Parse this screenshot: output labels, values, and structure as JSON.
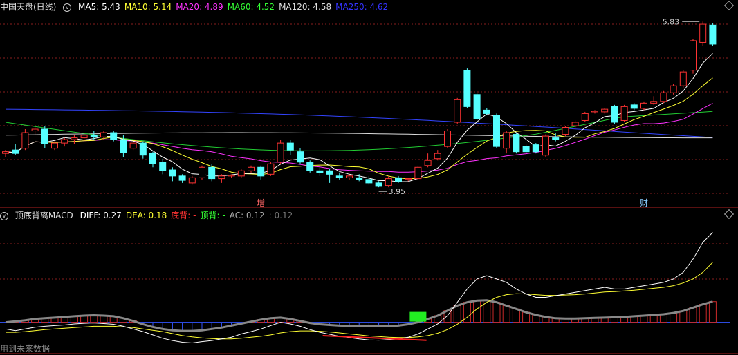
{
  "chart_data": [
    {
      "type": "candlestick",
      "title": "中国天盘(日线)",
      "ma_legend": [
        {
          "label": "MA5: 5.43",
          "color": "#ffffff"
        },
        {
          "label": "MA10: 5.14",
          "color": "#ffff33"
        },
        {
          "label": "MA20: 4.89",
          "color": "#ff33ff"
        },
        {
          "label": "MA60: 4.52",
          "color": "#33ff33"
        },
        {
          "label": "MA120: 4.58",
          "color": "#dddddd"
        },
        {
          "label": "MA250: 4.62",
          "color": "#3333ff"
        }
      ],
      "ylim": [
        3.8,
        5.95
      ],
      "high_label": "5.83",
      "low_label": "3.95",
      "candles": [
        [
          4.34,
          4.38,
          4.3,
          4.36
        ],
        [
          4.38,
          4.45,
          4.32,
          4.34
        ],
        [
          4.4,
          4.62,
          4.38,
          4.58
        ],
        [
          4.6,
          4.66,
          4.56,
          4.62
        ],
        [
          4.62,
          4.66,
          4.4,
          4.45
        ],
        [
          4.4,
          4.48,
          4.38,
          4.46
        ],
        [
          4.46,
          4.52,
          4.42,
          4.5
        ],
        [
          4.5,
          4.55,
          4.45,
          4.52
        ],
        [
          4.52,
          4.58,
          4.48,
          4.55
        ],
        [
          4.55,
          4.6,
          4.5,
          4.53
        ],
        [
          4.53,
          4.6,
          4.5,
          4.58
        ],
        [
          4.58,
          4.6,
          4.48,
          4.5
        ],
        [
          4.5,
          4.55,
          4.3,
          4.35
        ],
        [
          4.4,
          4.48,
          4.38,
          4.46
        ],
        [
          4.46,
          4.48,
          4.28,
          4.32
        ],
        [
          4.34,
          4.36,
          4.18,
          4.22
        ],
        [
          4.24,
          4.28,
          4.1,
          4.14
        ],
        [
          4.15,
          4.18,
          4.02,
          4.08
        ],
        [
          4.08,
          4.1,
          4.0,
          4.03
        ],
        [
          4.0,
          4.08,
          3.98,
          4.06
        ],
        [
          4.06,
          4.2,
          4.04,
          4.18
        ],
        [
          4.18,
          4.22,
          4.02,
          4.05
        ],
        [
          4.05,
          4.1,
          4.0,
          4.08
        ],
        [
          4.08,
          4.1,
          4.06,
          4.09
        ],
        [
          4.08,
          4.16,
          4.06,
          4.14
        ],
        [
          4.14,
          4.2,
          4.12,
          4.18
        ],
        [
          4.18,
          4.2,
          4.04,
          4.08
        ],
        [
          4.1,
          4.24,
          4.08,
          4.22
        ],
        [
          4.24,
          4.5,
          4.22,
          4.46
        ],
        [
          4.46,
          4.5,
          4.32,
          4.38
        ],
        [
          4.36,
          4.4,
          4.22,
          4.24
        ],
        [
          4.24,
          4.26,
          4.12,
          4.14
        ],
        [
          4.14,
          4.18,
          4.08,
          4.12
        ],
        [
          4.14,
          4.16,
          4.0,
          4.1
        ],
        [
          4.08,
          4.12,
          4.04,
          4.06
        ],
        [
          4.06,
          4.1,
          4.04,
          4.08
        ],
        [
          4.06,
          4.1,
          4.02,
          4.04
        ],
        [
          4.04,
          4.08,
          3.98,
          4.0
        ],
        [
          4.0,
          4.02,
          3.95,
          3.96
        ],
        [
          3.97,
          4.08,
          3.95,
          4.05
        ],
        [
          4.06,
          4.08,
          4.0,
          4.02
        ],
        [
          4.04,
          4.06,
          4.02,
          4.05
        ],
        [
          4.05,
          4.2,
          4.04,
          4.18
        ],
        [
          4.2,
          4.34,
          4.18,
          4.26
        ],
        [
          4.28,
          4.38,
          4.26,
          4.34
        ],
        [
          4.42,
          4.62,
          4.4,
          4.6
        ],
        [
          4.7,
          4.98,
          4.68,
          4.96
        ],
        [
          5.3,
          5.32,
          4.86,
          4.88
        ],
        [
          5.02,
          5.04,
          4.72,
          4.74
        ],
        [
          4.84,
          4.86,
          4.78,
          4.8
        ],
        [
          4.78,
          4.8,
          4.4,
          4.42
        ],
        [
          4.4,
          4.6,
          4.34,
          4.58
        ],
        [
          4.56,
          4.58,
          4.34,
          4.36
        ],
        [
          4.42,
          4.44,
          4.34,
          4.36
        ],
        [
          4.44,
          4.46,
          4.34,
          4.36
        ],
        [
          4.32,
          4.56,
          4.3,
          4.54
        ],
        [
          4.52,
          4.58,
          4.48,
          4.5
        ],
        [
          4.56,
          4.66,
          4.54,
          4.64
        ],
        [
          4.66,
          4.72,
          4.62,
          4.7
        ],
        [
          4.72,
          4.82,
          4.7,
          4.8
        ],
        [
          4.82,
          4.84,
          4.8,
          4.83
        ],
        [
          4.82,
          4.86,
          4.8,
          4.85
        ],
        [
          4.88,
          4.9,
          4.68,
          4.7
        ],
        [
          4.72,
          4.9,
          4.7,
          4.88
        ],
        [
          4.9,
          4.92,
          4.84,
          4.86
        ],
        [
          4.86,
          4.94,
          4.84,
          4.92
        ],
        [
          4.92,
          5.0,
          4.9,
          4.94
        ],
        [
          4.94,
          5.06,
          4.92,
          5.04
        ],
        [
          5.04,
          5.14,
          5.02,
          5.12
        ],
        [
          5.12,
          5.3,
          5.1,
          5.28
        ],
        [
          5.3,
          5.66,
          5.26,
          5.64
        ],
        [
          5.62,
          5.86,
          5.58,
          5.83
        ],
        [
          5.82,
          5.84,
          5.58,
          5.6
        ]
      ],
      "markers": [
        {
          "index": 26,
          "label": "增",
          "color": "#ff6666"
        },
        {
          "index": 65,
          "label": "财",
          "color": "#88ccff"
        }
      ]
    },
    {
      "type": "line",
      "title": "顶底背离MACD",
      "legend": [
        {
          "label": "DIFF: 0.27",
          "color": "#ffffff"
        },
        {
          "label": "DEA: 0.18",
          "color": "#ffff33"
        },
        {
          "label": "底背: -",
          "color": "#ff3333"
        },
        {
          "label": "顶背: -",
          "color": "#33ff33"
        },
        {
          "label": "AC: 0.12",
          "color": "#aaaaaa"
        },
        {
          "label": ": 0.12",
          "color": "#777777"
        }
      ],
      "ylim": [
        -0.09,
        0.3
      ],
      "diff": [
        -0.02,
        -0.025,
        -0.02,
        -0.015,
        -0.012,
        -0.01,
        -0.008,
        -0.005,
        -0.003,
        -0.002,
        -0.004,
        -0.006,
        -0.012,
        -0.02,
        -0.028,
        -0.038,
        -0.048,
        -0.055,
        -0.06,
        -0.062,
        -0.058,
        -0.055,
        -0.05,
        -0.045,
        -0.035,
        -0.028,
        -0.02,
        -0.01,
        0.0,
        -0.005,
        -0.012,
        -0.022,
        -0.03,
        -0.036,
        -0.042,
        -0.046,
        -0.05,
        -0.053,
        -0.054,
        -0.052,
        -0.05,
        -0.045,
        -0.035,
        -0.02,
        -0.005,
        0.02,
        0.06,
        0.1,
        0.13,
        0.14,
        0.13,
        0.12,
        0.1,
        0.085,
        0.075,
        0.075,
        0.08,
        0.085,
        0.09,
        0.095,
        0.1,
        0.105,
        0.1,
        0.1,
        0.105,
        0.11,
        0.115,
        0.12,
        0.13,
        0.15,
        0.19,
        0.24,
        0.27
      ],
      "dea": [
        -0.03,
        -0.03,
        -0.028,
        -0.025,
        -0.022,
        -0.02,
        -0.018,
        -0.016,
        -0.014,
        -0.012,
        -0.012,
        -0.012,
        -0.014,
        -0.016,
        -0.02,
        -0.024,
        -0.028,
        -0.034,
        -0.04,
        -0.044,
        -0.047,
        -0.049,
        -0.05,
        -0.05,
        -0.048,
        -0.045,
        -0.042,
        -0.038,
        -0.032,
        -0.028,
        -0.026,
        -0.026,
        -0.027,
        -0.029,
        -0.032,
        -0.035,
        -0.038,
        -0.041,
        -0.043,
        -0.045,
        -0.046,
        -0.046,
        -0.044,
        -0.04,
        -0.033,
        -0.022,
        -0.006,
        0.015,
        0.04,
        0.06,
        0.075,
        0.083,
        0.086,
        0.085,
        0.083,
        0.081,
        0.081,
        0.082,
        0.083,
        0.085,
        0.088,
        0.091,
        0.092,
        0.094,
        0.096,
        0.099,
        0.102,
        0.105,
        0.11,
        0.118,
        0.13,
        0.15,
        0.18
      ],
      "hist": [
        0.0,
        0.003,
        0.006,
        0.01,
        0.012,
        0.014,
        0.016,
        0.018,
        0.02,
        0.021,
        0.02,
        0.018,
        0.012,
        0.004,
        -0.006,
        -0.014,
        -0.02,
        -0.024,
        -0.026,
        -0.026,
        -0.024,
        -0.02,
        -0.016,
        -0.01,
        -0.004,
        0.002,
        0.008,
        0.012,
        0.014,
        0.01,
        0.004,
        -0.002,
        -0.006,
        -0.008,
        -0.01,
        -0.011,
        -0.012,
        -0.012,
        -0.012,
        -0.012,
        -0.01,
        -0.006,
        0.0,
        0.01,
        0.02,
        0.035,
        0.05,
        0.06,
        0.065,
        0.066,
        0.06,
        0.05,
        0.04,
        0.03,
        0.022,
        0.016,
        0.012,
        0.011,
        0.011,
        0.012,
        0.013,
        0.014,
        0.015,
        0.016,
        0.018,
        0.02,
        0.022,
        0.024,
        0.028,
        0.034,
        0.044,
        0.054,
        0.062
      ],
      "bottom_divergence": [
        33,
        43
      ],
      "signal_box_index": 42
    }
  ],
  "footer_text": "用到未来数据"
}
